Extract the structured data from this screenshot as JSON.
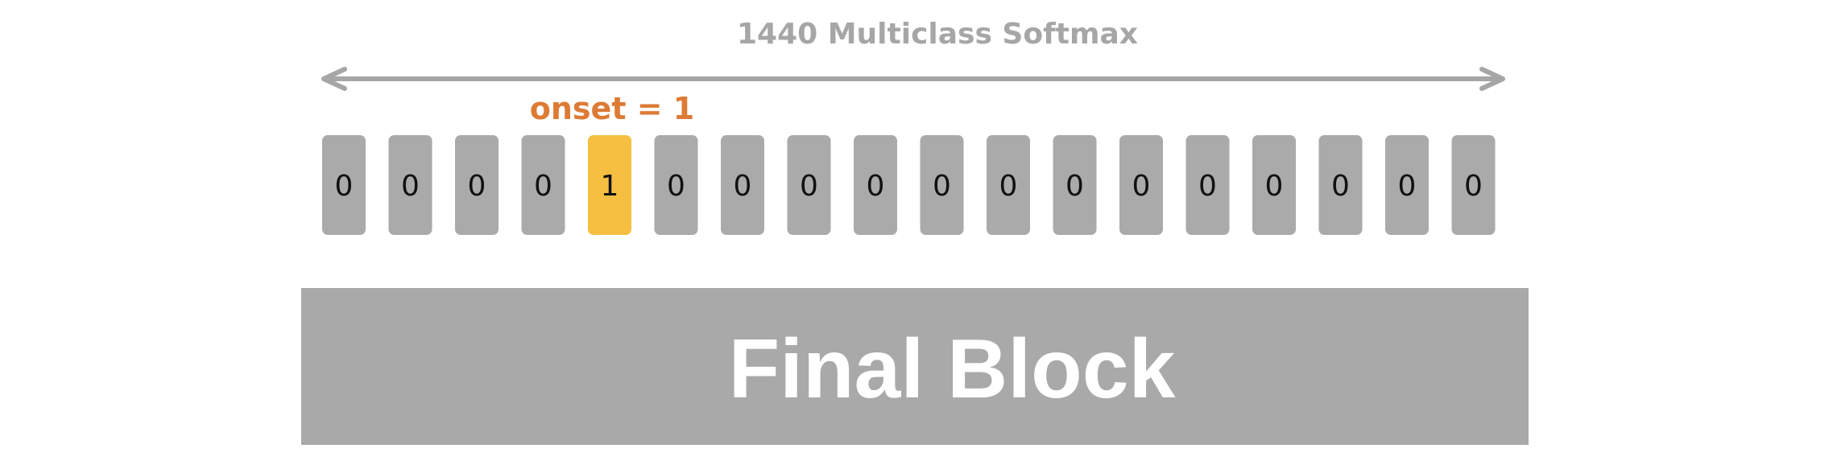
{
  "title": "1440 Multiclass Softmax",
  "onset_label": "onset = 1",
  "cells": [
    "0",
    "0",
    "0",
    "0",
    "1",
    "0",
    "0",
    "0",
    "0",
    "0",
    "0",
    "0",
    "0",
    "0",
    "0",
    "0",
    "0",
    "0"
  ],
  "active_index": 4,
  "block_label": "Final Block",
  "colors": {
    "cell": "#aaaaaa",
    "active_cell": "#f6bf41",
    "arrow": "#a6a6a6",
    "title": "#a6a6a6",
    "onset": "#dd7b35",
    "block": "#a9a9a9",
    "block_text": "#ffffff",
    "cell_text": "#111111"
  }
}
